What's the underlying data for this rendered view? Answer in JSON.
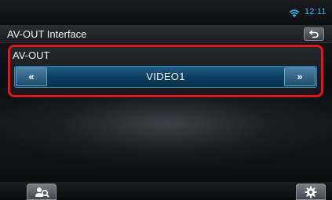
{
  "status_bar": {
    "clock": "12:11",
    "wifi_icon": "wifi-icon",
    "clock_color": "#3fb4e8"
  },
  "header": {
    "title": "AV-OUT Interface",
    "back_icon": "back-arrow-icon"
  },
  "panel": {
    "label": "AV-OUT",
    "prev_label": "«",
    "next_label": "»",
    "value": "VIDEO1",
    "highlight_color": "#e2141c",
    "accent_color": "#1e5f86"
  },
  "bottom_bar": {
    "left_icon": "search-person-icon",
    "right_icon": "gear-icon"
  }
}
